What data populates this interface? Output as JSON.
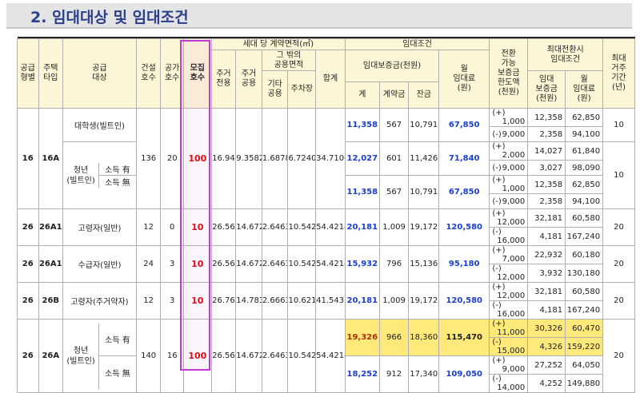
{
  "section_title": "2. 임대대상 및 임대조건",
  "headers": {
    "supply_type": "공급\n형별",
    "housing_type": "주택\n타입",
    "target": "공급\n대상",
    "built": "건설\n호수",
    "vacant": "공가\n호수",
    "recruit": "모집\n호수",
    "area_group": "세대 당 계약면적(㎡)",
    "exclusive": "주거\n전용",
    "shared": "주거\n공용",
    "other_group": "그 밖의\n공용면적",
    "other_common": "기타\n공용",
    "parking": "주차장",
    "total": "합계",
    "cond_group": "임대조건",
    "deposit_group": "임대보증금(천원)",
    "dep_total": "계",
    "contract": "계약금",
    "balance": "잔금",
    "rent": "월\n임대료\n(원)",
    "conv_limit": "전환\n가능\n보증금\n한도액\n(천원)",
    "max_group": "최대전환시\n임대조건",
    "max_deposit": "임대\n보증금\n(천원)",
    "max_rent": "월\n임대료\n(원)",
    "period": "최대\n거주\n기간\n(년)"
  },
  "rows": {
    "r1": {
      "type": "16",
      "htype": "16A",
      "built": "136",
      "vacant": "20",
      "recruit": "100",
      "excl": "16.94",
      "shr": "9.3582",
      "oth": "1.6878",
      "park": "6.7240",
      "tot": "34.7100",
      "student": "대학생(빌트인)",
      "youth": "청년\n(빌트인)",
      "inc_yes": "소득 有",
      "inc_no": "소득 無",
      "a": {
        "dep": "11,358",
        "ct": "567",
        "bal": "10,791",
        "rent": "67,850",
        "period": "10",
        "c1": {
          "s": "(+)",
          "lim": "1,000",
          "md": "12,358",
          "mr": "62,850"
        },
        "c2": {
          "s": "(-)",
          "lim": "9,000",
          "md": "2,358",
          "mr": "94,100"
        }
      },
      "b": {
        "dep": "12,027",
        "ct": "601",
        "bal": "11,426",
        "rent": "71,840",
        "period": "10",
        "c1": {
          "s": "(+)",
          "lim": "2,000",
          "md": "14,027",
          "mr": "61,840"
        },
        "c2": {
          "s": "(-)",
          "lim": "9,000",
          "md": "3,027",
          "mr": "98,090"
        }
      },
      "c": {
        "dep": "11,358",
        "ct": "567",
        "bal": "10,791",
        "rent": "67,850",
        "c1": {
          "s": "(+)",
          "lim": "1,000",
          "md": "12,358",
          "mr": "62,850"
        },
        "c2": {
          "s": "(-)",
          "lim": "9,000",
          "md": "2,358",
          "mr": "94,100"
        }
      }
    },
    "r2": {
      "type": "26",
      "htype": "26A1",
      "target": "고령자(일반)",
      "built": "12",
      "vacant": "0",
      "recruit": "10",
      "excl": "26.56",
      "shr": "14.6726",
      "oth": "2.6463",
      "park": "10.5425",
      "tot": "54.4214",
      "dep": "20,181",
      "ct": "1,009",
      "bal": "19,172",
      "rent": "120,580",
      "period": "20",
      "c1": {
        "s": "(+)",
        "lim": "12,000",
        "md": "32,181",
        "mr": "60,580"
      },
      "c2": {
        "s": "(-)",
        "lim": "16,000",
        "md": "4,181",
        "mr": "167,240"
      }
    },
    "r3": {
      "type": "26",
      "htype": "26A1",
      "target": "수급자(일반)",
      "built": "24",
      "vacant": "3",
      "recruit": "10",
      "excl": "26.56",
      "shr": "14.6726",
      "oth": "2.6463",
      "park": "10.5425",
      "tot": "54.4214",
      "dep": "15,932",
      "ct": "796",
      "bal": "15,136",
      "rent": "95,180",
      "period": "20",
      "c1": {
        "s": "(+)",
        "lim": "7,000",
        "md": "22,932",
        "mr": "60,180"
      },
      "c2": {
        "s": "(-)",
        "lim": "12,000",
        "md": "3,932",
        "mr": "130,180"
      }
    },
    "r4": {
      "type": "26",
      "htype": "26B",
      "target": "고령자(주거약자)",
      "built": "12",
      "vacant": "3",
      "recruit": "10",
      "excl": "26.76",
      "shr": "14.7831",
      "oth": "2.6663",
      "park": "10.6219",
      "tot": "41.5431",
      "dep": "20,181",
      "ct": "1,009",
      "bal": "19,172",
      "rent": "120,580",
      "period": "20",
      "c1": {
        "s": "(+)",
        "lim": "12,000",
        "md": "32,181",
        "mr": "60,580"
      },
      "c2": {
        "s": "(-)",
        "lim": "16,000",
        "md": "4,181",
        "mr": "167,240"
      }
    },
    "r5": {
      "type": "26",
      "htype": "26A",
      "youth": "청년\n(빌트인)",
      "inc_yes": "소득 有",
      "inc_no": "소득 無",
      "built": "140",
      "vacant": "16",
      "recruit": "100",
      "excl": "26.56",
      "shr": "14.6726",
      "oth": "2.6463",
      "park": "10.5425",
      "tot": "54.4214",
      "period": "20",
      "a": {
        "dep": "19,326",
        "ct": "966",
        "bal": "18,360",
        "rent": "115,470",
        "c1": {
          "s": "(+)",
          "lim": "11,000",
          "md": "30,326",
          "mr": "60,470"
        },
        "c2": {
          "s": "(-)",
          "lim": "15,000",
          "md": "4,326",
          "mr": "159,220"
        }
      },
      "b": {
        "dep": "18,252",
        "ct": "912",
        "bal": "17,340",
        "rent": "109,050",
        "c1": {
          "s": "(+)",
          "lim": "9,000",
          "md": "27,252",
          "mr": "64,050"
        },
        "c2": {
          "s": "(-)",
          "lim": "14,000",
          "md": "4,252",
          "mr": "149,880"
        }
      }
    }
  }
}
